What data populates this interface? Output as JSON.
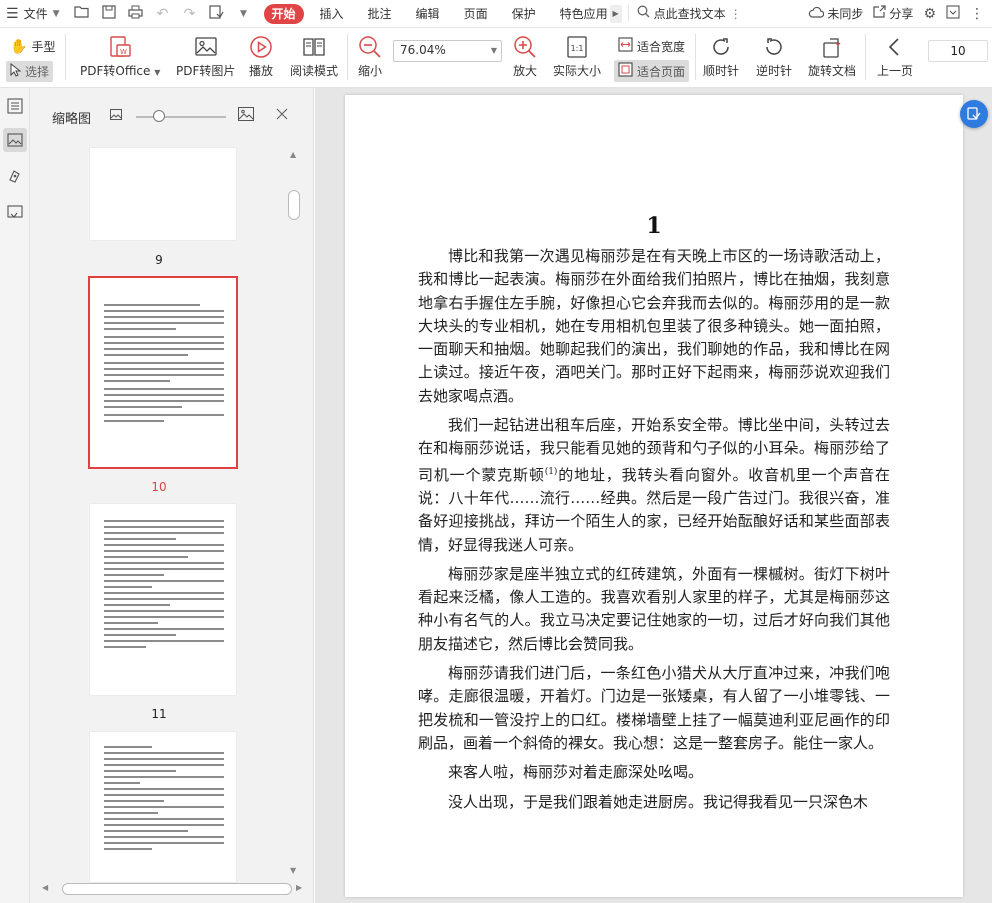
{
  "menubar": {
    "file_label": "文件",
    "tabs": [
      {
        "label": "开始",
        "active": true
      },
      {
        "label": "插入",
        "active": false
      },
      {
        "label": "批注",
        "active": false
      },
      {
        "label": "编辑",
        "active": false
      },
      {
        "label": "页面",
        "active": false
      },
      {
        "label": "保护",
        "active": false
      },
      {
        "label": "特色应用",
        "active": false
      }
    ],
    "search_placeholder": "点此查找文本",
    "sync_label": "未同步",
    "share_label": "分享",
    "accent_color": "#e04444"
  },
  "toolbar": {
    "hand_label": "手型",
    "select_label": "选择",
    "pdf_to_office_label": "PDF转Office",
    "pdf_to_image_label": "PDF转图片",
    "play_label": "播放",
    "read_mode_label": "阅读模式",
    "zoom_out_label": "缩小",
    "zoom_value": "76.04%",
    "zoom_in_label": "放大",
    "actual_size_label": "实际大小",
    "fit_width_label": "适合宽度",
    "fit_page_label": "适合页面",
    "rotate_cw_label": "顺时针",
    "rotate_ccw_label": "逆时针",
    "rotate_doc_label": "旋转文档",
    "prev_page_label": "上一页",
    "page_number": "10"
  },
  "thumbnail_panel": {
    "title": "缩略图",
    "pages": [
      {
        "label": "9",
        "selected": false
      },
      {
        "label": "10",
        "selected": true
      },
      {
        "label": "11",
        "selected": false
      }
    ]
  },
  "document": {
    "page_number": "1",
    "paragraphs": [
      "博比和我第一次遇见梅丽莎是在有天晚上市区的一场诗歌活动上，我和博比一起表演。梅丽莎在外面给我们拍照片，博比在抽烟，我刻意地拿右手握住左手腕，好像担心它会弃我而去似的。梅丽莎用的是一款大块头的专业相机，她在专用相机包里装了很多种镜头。她一面拍照，一面聊天和抽烟。她聊起我们的演出，我们聊她的作品，我和博比在网上读过。接近午夜，酒吧关门。那时正好下起雨来，梅丽莎说欢迎我们去她家喝点酒。",
      "我们一起钻进出租车后座，开始系安全带。博比坐中间，头转过去在和梅丽莎说话，我只能看见她的颈背和勺子似的小耳朵。梅丽莎给了司机一个蒙克斯顿",
      "的地址，我转头看向窗外。收音机里一个声音在说：八十年代……流行……经典。然后是一段广告过门。我很兴奋，准备好迎接挑战，拜访一个陌生人的家，已经开始酝酿好话和某些面部表情，好显得我迷人可亲。",
      "梅丽莎家是座半独立式的红砖建筑，外面有一棵槭树。街灯下树叶看起来泛橘，像人工造的。我喜欢看别人家里的样子，尤其是梅丽莎这种小有名气的人。我立马决定要记住她家的一切，过后才好向我们其他朋友描述它，然后博比会赞同我。",
      "梅丽莎请我们进门后，一条红色小猎犬从大厅直冲过来，冲我们咆哮。走廊很温暖，开着灯。门边是一张矮桌，有人留了一小堆零钱、一把发梳和一管没拧上的口红。楼梯墙壁上挂了一幅莫迪利亚尼画作的印刷品，画着一个斜倚的裸女。我心想：这是一整套房子。能住一家人。",
      "来客人啦，梅丽莎对着走廊深处吆喝。",
      "没人出现，于是我们跟着她走进厨房。我记得我看见一只深色木"
    ],
    "footnote_mark": "(1)"
  }
}
